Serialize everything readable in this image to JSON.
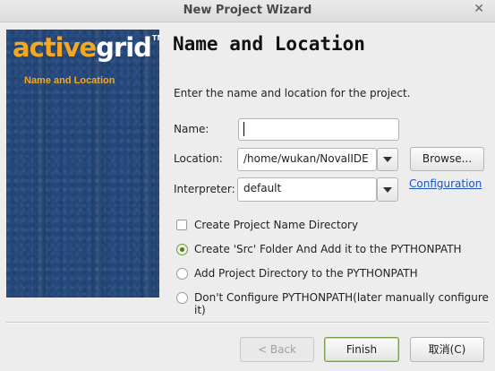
{
  "window": {
    "title": "New Project Wizard"
  },
  "sidebar": {
    "logo_part1": "active",
    "logo_part2": "grid",
    "logo_tm": "TM",
    "step": "Name and Location"
  },
  "main": {
    "heading": "Name and Location",
    "instruction": "Enter the name and location for the project.",
    "name_label": "Name:",
    "name_value": "",
    "location_label": "Location:",
    "location_value": "/home/wukan/NovalIDE",
    "browse_label": "Browse...",
    "interpreter_label": "Interpreter:",
    "interpreter_value": "default",
    "configuration_link": "Configuration",
    "create_dir_label": "Create Project Name Directory",
    "create_dir_checked": false,
    "python_path_options": [
      {
        "label": "Create 'Src' Folder And Add it to the PYTHONPATH",
        "selected": true
      },
      {
        "label": "Add Project Directory to the PYTHONPATH",
        "selected": false
      },
      {
        "label": "Don't Configure PYTHONPATH(later manually configure it)",
        "selected": false
      }
    ]
  },
  "footer": {
    "back_label": "< Back",
    "finish_label": "Finish",
    "cancel_label": "取消(C)"
  },
  "colors": {
    "sidebar_bg": "#23477b",
    "accent_orange": "#f5a71f",
    "link_blue": "#1a55c0",
    "radio_green": "#4d7f1f"
  }
}
